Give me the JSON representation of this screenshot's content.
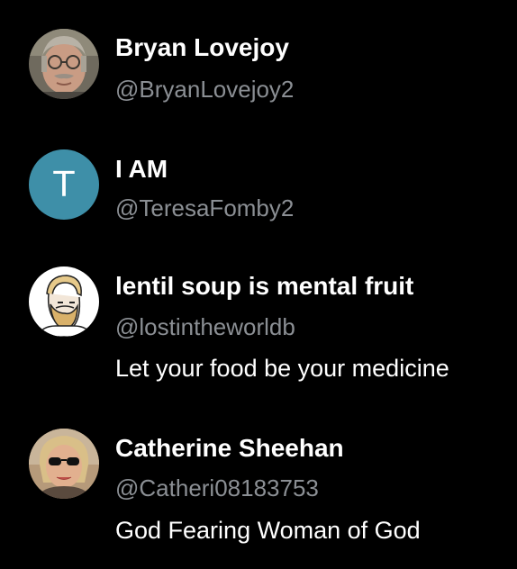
{
  "users": [
    {
      "name": "Bryan Lovejoy",
      "handle": "@BryanLovejoy2",
      "bio": "",
      "avatar_icon": "man-with-glasses-photo"
    },
    {
      "name": "I AM",
      "handle": "@TeresaFomby2",
      "bio": "",
      "avatar_icon": "letter-initial",
      "avatar_letter": "T",
      "avatar_color": "#3e8fa8"
    },
    {
      "name": "lentil soup is mental fruit",
      "handle": "@lostintheworldb",
      "bio": "Let your food be your medicine",
      "avatar_icon": "bearded-man-drawing"
    },
    {
      "name": "Catherine Sheehan",
      "handle": "@Catheri08183753",
      "bio": "God Fearing Woman of God",
      "avatar_icon": "woman-with-sunglasses-photo"
    }
  ]
}
